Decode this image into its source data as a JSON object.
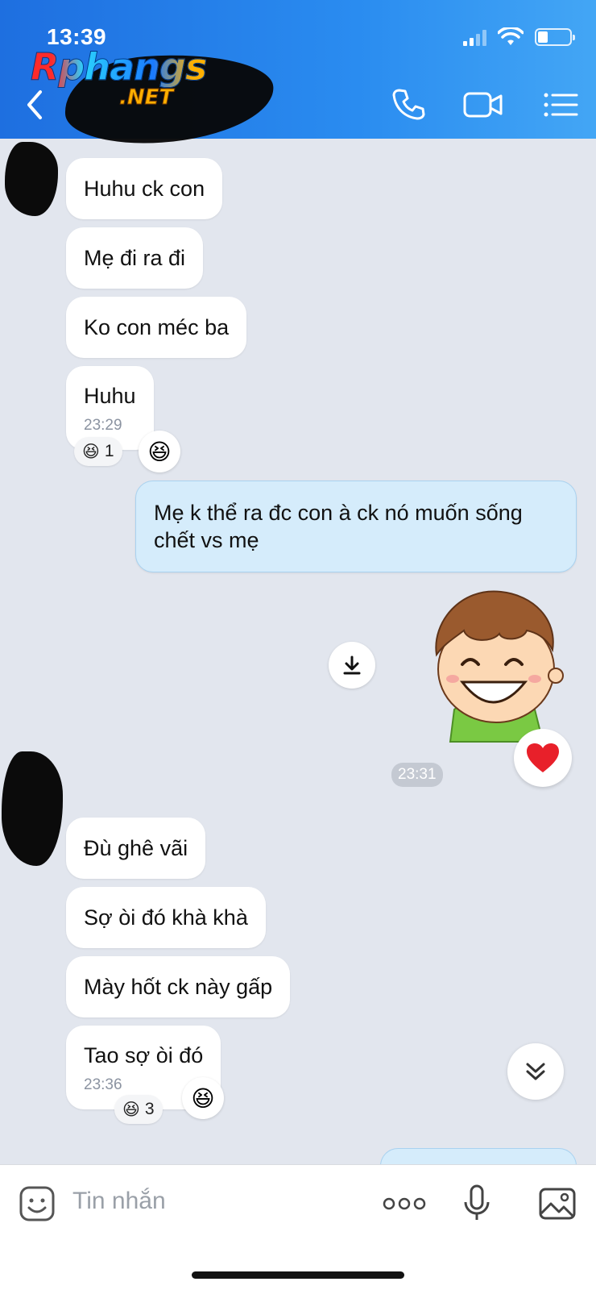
{
  "status_bar": {
    "time": "13:39"
  },
  "watermark": {
    "main": "Rphangs",
    "sub": ".NET"
  },
  "header": {
    "back_icon": "chevron-left-icon",
    "call_icon": "phone-icon",
    "video_icon": "video-camera-icon",
    "menu_icon": "list-menu-icon"
  },
  "messages": {
    "m1": "Huhu ck con",
    "m2": "Mẹ đi ra đi",
    "m3": "Ko con méc ba",
    "m4": "Huhu",
    "m4_time": "23:29",
    "m4_reaction_count": "1",
    "m5": "Mẹ k thể ra đc con à ck nó muốn sống chết vs mẹ",
    "sticker_time": "23:31",
    "m6": "Đù ghê vãi",
    "m7": "Sợ òi đó khà khà",
    "m8": "Mày hốt ck này gấp",
    "m9": "Tao sợ òi đó",
    "m9_time": "23:36",
    "m9_reaction_count": "3"
  },
  "composer": {
    "placeholder": "Tin nhắn",
    "emoji_icon": "sticker-emoji-icon",
    "more_icon": "more-dots-icon",
    "mic_icon": "microphone-icon",
    "image_icon": "image-icon"
  },
  "colors": {
    "header_start": "#1e6fe0",
    "header_end": "#43a6f5",
    "chat_bg": "#e2e6ee",
    "my_bubble": "#d5ecfb"
  }
}
